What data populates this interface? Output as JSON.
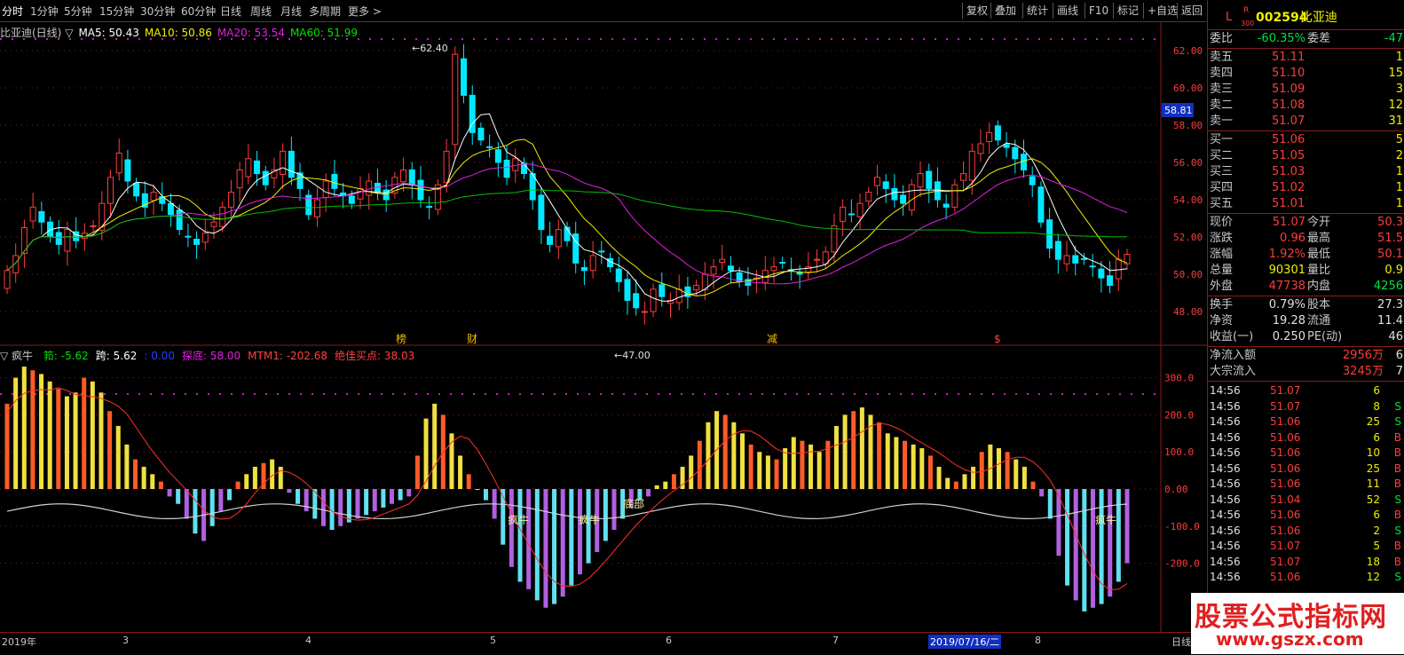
{
  "toolbar": {
    "periods": [
      "分时",
      "1分钟",
      "5分钟",
      "15分钟",
      "30分钟",
      "60分钟",
      "日线",
      "周线",
      "月线",
      "多周期",
      "更多 >"
    ],
    "right_buttons": [
      "复权",
      "叠加",
      "统计",
      "画线",
      "F10",
      "标记",
      "+自选",
      "返回"
    ]
  },
  "chart": {
    "title": "比亚迪(日线)",
    "ma_label": "▽",
    "ma": [
      {
        "name": "MA5: 50.43",
        "color": "#ffffff"
      },
      {
        "name": "MA10: 50.86",
        "color": "#f0f000"
      },
      {
        "name": "MA20: 53.54",
        "color": "#e020e0"
      },
      {
        "name": "MA60: 51.99",
        "color": "#00e000"
      }
    ],
    "high_label": "62.40",
    "low_label": "47.00",
    "price_ticks": [
      "62.00",
      "60.00",
      "58.00",
      "56.00",
      "54.00",
      "52.00",
      "50.00",
      "48.00"
    ],
    "cursor_price": "58.81",
    "event_marks": [
      {
        "text": "榜",
        "color": "#f0c000"
      },
      {
        "text": "财",
        "color": "#f0c000"
      },
      {
        "text": "减",
        "color": "#f0c000"
      },
      {
        "text": "$",
        "color": "#ff4040"
      }
    ],
    "colors": {
      "up": "#ff3c3c",
      "down": "#00e8ff",
      "grid": "#8a1a1a",
      "bg": "#000000"
    }
  },
  "indicator": {
    "name": "▽ 疯牛",
    "values": [
      {
        "text": "筘: -5.62",
        "color": "#00e000"
      },
      {
        "text": "跨: 5.62",
        "color": "#ffffff"
      },
      {
        "text": ": 0.00",
        "color": "#2040ff"
      },
      {
        "text": "探底: 58.00",
        "color": "#e020e0"
      },
      {
        "text": "MTM1: -202.68",
        "color": "#ff4040"
      },
      {
        "text": "绝佳买点: 38.03",
        "color": "#ff4040"
      }
    ],
    "ticks": [
      "300.0",
      "200.0",
      "100.0",
      "0.00",
      "-100.0",
      "-200.0"
    ],
    "labels": [
      "疯牛",
      "疯牛",
      "底部",
      "疯牛"
    ]
  },
  "xaxis": {
    "labels": [
      "2019年",
      "3",
      "4",
      "5",
      "6",
      "7",
      "2019/07/16/二",
      "8"
    ],
    "period": "日线"
  },
  "panel": {
    "code_prefix": "L",
    "code_sup": "R",
    "code_sub": "300",
    "code": "002594",
    "name": "比亚迪",
    "webi_label": "委比",
    "webi": "-60.35%",
    "weicha_label": "委差",
    "weicha": "-47",
    "sell": [
      {
        "label": "卖五",
        "price": "51.11",
        "vol": "1"
      },
      {
        "label": "卖四",
        "price": "51.10",
        "vol": "15"
      },
      {
        "label": "卖三",
        "price": "51.09",
        "vol": "3"
      },
      {
        "label": "卖二",
        "price": "51.08",
        "vol": "12"
      },
      {
        "label": "卖一",
        "price": "51.07",
        "vol": "31"
      }
    ],
    "buy": [
      {
        "label": "买一",
        "price": "51.06",
        "vol": "5"
      },
      {
        "label": "买二",
        "price": "51.05",
        "vol": "2"
      },
      {
        "label": "买三",
        "price": "51.03",
        "vol": "1"
      },
      {
        "label": "买四",
        "price": "51.02",
        "vol": "1"
      },
      {
        "label": "买五",
        "price": "51.01",
        "vol": "1"
      }
    ],
    "quote": [
      {
        "l1": "现价",
        "v1": "51.07",
        "c1": "red",
        "l2": "今开",
        "v2": "50.3",
        "c2": "red"
      },
      {
        "l1": "涨跌",
        "v1": "0.96",
        "c1": "red",
        "l2": "最高",
        "v2": "51.5",
        "c2": "red"
      },
      {
        "l1": "涨幅",
        "v1": "1.92%",
        "c1": "red",
        "l2": "最低",
        "v2": "50.1",
        "c2": "red"
      },
      {
        "l1": "总量",
        "v1": "90301",
        "c1": "yellow",
        "l2": "量比",
        "v2": "0.9",
        "c2": "yellow"
      },
      {
        "l1": "外盘",
        "v1": "47738",
        "c1": "red",
        "l2": "内盘",
        "v2": "4256",
        "c2": "green"
      }
    ],
    "stats": [
      {
        "l1": "换手",
        "v1": "0.79%",
        "l2": "股本",
        "v2": "27.3"
      },
      {
        "l1": "净资",
        "v1": "19.28",
        "l2": "流通",
        "v2": "11.4"
      },
      {
        "l1": "收益(一)",
        "v1": "0.250",
        "l2": "PE(动)",
        "v2": "46"
      }
    ],
    "flows": [
      {
        "label": "净流入额",
        "value": "2956万",
        "extra": "6"
      },
      {
        "label": "大宗流入",
        "value": "3245万",
        "extra": "7"
      }
    ],
    "ticks": [
      {
        "t": "14:56",
        "p": "51.07",
        "v": "6",
        "d": ""
      },
      {
        "t": "14:56",
        "p": "51.07",
        "v": "8",
        "d": "S"
      },
      {
        "t": "14:56",
        "p": "51.06",
        "v": "25",
        "d": "S"
      },
      {
        "t": "14:56",
        "p": "51.06",
        "v": "6",
        "d": "B"
      },
      {
        "t": "14:56",
        "p": "51.06",
        "v": "10",
        "d": "B"
      },
      {
        "t": "14:56",
        "p": "51.06",
        "v": "25",
        "d": "B"
      },
      {
        "t": "14:56",
        "p": "51.06",
        "v": "11",
        "d": "B"
      },
      {
        "t": "14:56",
        "p": "51.04",
        "v": "52",
        "d": "S"
      },
      {
        "t": "14:56",
        "p": "51.06",
        "v": "6",
        "d": "B"
      },
      {
        "t": "14:56",
        "p": "51.06",
        "v": "2",
        "d": "S"
      },
      {
        "t": "14:56",
        "p": "51.07",
        "v": "5",
        "d": "B"
      },
      {
        "t": "14:56",
        "p": "51.07",
        "v": "18",
        "d": "B"
      },
      {
        "t": "14:56",
        "p": "51.06",
        "v": "12",
        "d": "S"
      }
    ]
  },
  "watermark": {
    "title": "股票公式指标网",
    "url": "www.gszx.com"
  }
}
